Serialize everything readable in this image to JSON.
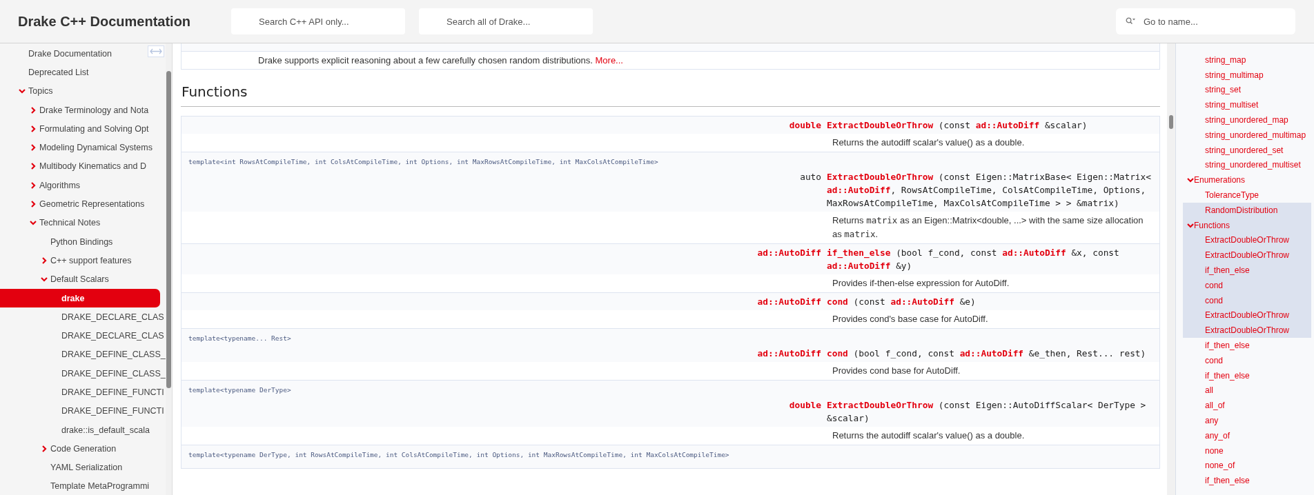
{
  "header": {
    "title": "Drake C++ Documentation",
    "search_fields": [
      {
        "placeholder": "Search C++ API only..."
      },
      {
        "placeholder": "Search all of Drake..."
      }
    ],
    "go_to": {
      "placeholder": "Go to name..."
    }
  },
  "sidebar": {
    "items": [
      {
        "label": "Drake Documentation",
        "selected": false
      },
      {
        "label": "Deprecated List",
        "selected": false
      },
      {
        "label": "Topics",
        "expanded": true,
        "selected": false,
        "children": [
          {
            "label": "Drake Terminology and Nota",
            "expanded": false,
            "selected": false
          },
          {
            "label": "Formulating and Solving Opt",
            "expanded": false,
            "selected": false
          },
          {
            "label": "Modeling Dynamical Systems",
            "expanded": false,
            "selected": false
          },
          {
            "label": "Multibody Kinematics and D",
            "expanded": false,
            "selected": false
          },
          {
            "label": "Algorithms",
            "expanded": false,
            "selected": false
          },
          {
            "label": "Geometric Representations",
            "expanded": false,
            "selected": false
          },
          {
            "label": "Technical Notes",
            "expanded": true,
            "selected": false,
            "children": [
              {
                "label": "Python Bindings",
                "selected": false
              },
              {
                "label": "C++ support features",
                "expanded": false,
                "selected": false
              },
              {
                "label": "Default Scalars",
                "expanded": true,
                "selected": false,
                "children": [
                  {
                    "label": "drake",
                    "selected": true
                  },
                  {
                    "label": "DRAKE_DECLARE_CLAS",
                    "selected": false
                  },
                  {
                    "label": "DRAKE_DECLARE_CLAS",
                    "selected": false
                  },
                  {
                    "label": "DRAKE_DEFINE_CLASS_",
                    "selected": false
                  },
                  {
                    "label": "DRAKE_DEFINE_CLASS_",
                    "selected": false
                  },
                  {
                    "label": "DRAKE_DEFINE_FUNCTI",
                    "selected": false
                  },
                  {
                    "label": "DRAKE_DEFINE_FUNCTI",
                    "selected": false
                  },
                  {
                    "label": "drake::is_default_scala",
                    "selected": false
                  }
                ]
              },
              {
                "label": "Code Generation",
                "expanded": false,
                "selected": false
              },
              {
                "label": "YAML Serialization",
                "selected": false
              },
              {
                "label": "Template MetaProgrammi",
                "selected": false
              }
            ]
          }
        ]
      }
    ]
  },
  "summary": {
    "text": "Drake supports explicit reasoning about a few carefully chosen random distributions.",
    "link": "More..."
  },
  "functions": {
    "heading": "Functions",
    "rows": [
      {
        "return_type": "**double**",
        "signature": "**ExtractDoubleOrThrow** (const **ad::AutoDiff** &scalar)",
        "description": [
          {
            "kind": "text",
            "text": "Returns the autodiff scalar's value() as a double."
          }
        ]
      },
      {
        "template": "template<int RowsAtCompileTime, int ColsAtCompileTime, int Options, int MaxRowsAtCompileTime, int MaxColsAtCompileTime>",
        "return_type": "auto",
        "signature": "**ExtractDoubleOrThrow** (const Eigen::MatrixBase< Eigen::Matrix< **ad::AutoDiff**, RowsAtCompileTime, ColsAtCompileTime, Options, MaxRowsAtCompileTime, MaxColsAtCompileTime > > &matrix)",
        "description": [
          {
            "kind": "text",
            "text": "Returns "
          },
          {
            "kind": "code",
            "text": "matrix"
          },
          {
            "kind": "text",
            "text": " as an Eigen::Matrix<double, ...> with the same size allocation as "
          },
          {
            "kind": "code",
            "text": "matrix"
          },
          {
            "kind": "text",
            "text": "."
          }
        ]
      },
      {
        "return_type": "**ad::AutoDiff**",
        "signature": "**if_then_else** (bool f_cond, const **ad::AutoDiff** &x, const **ad::AutoDiff** &y)",
        "description": [
          {
            "kind": "text",
            "text": "Provides if-then-else expression for AutoDiff."
          }
        ]
      },
      {
        "return_type": "**ad::AutoDiff**",
        "signature": "**cond** (const **ad::AutoDiff** &e)",
        "description": [
          {
            "kind": "text",
            "text": "Provides cond's base case for AutoDiff."
          }
        ]
      },
      {
        "template": "template<typename... Rest>",
        "return_type": "**ad::AutoDiff**",
        "signature": "**cond** (bool f_cond, const **ad::AutoDiff** &e_then, Rest... rest)",
        "description": [
          {
            "kind": "text",
            "text": "Provides cond base for AutoDiff."
          }
        ]
      },
      {
        "template": "template<typename DerType>",
        "return_type": "**double**",
        "signature": "**ExtractDoubleOrThrow** (const Eigen::AutoDiffScalar< DerType > &scalar)",
        "description": [
          {
            "kind": "text",
            "text": "Returns the autodiff scalar's value() as a double."
          }
        ]
      },
      {
        "template": "template<typename DerType, int RowsAtCompileTime, int ColsAtCompileTime, int Options, int MaxRowsAtCompileTime, int MaxColsAtCompileTime>"
      }
    ]
  },
  "nav": {
    "continued": [
      {
        "label": "string_map",
        "highlighted": false
      },
      {
        "label": "string_multimap",
        "highlighted": false
      },
      {
        "label": "string_set",
        "highlighted": false
      },
      {
        "label": "string_multiset",
        "highlighted": false
      },
      {
        "label": "string_unordered_map",
        "highlighted": false
      },
      {
        "label": "string_unordered_multimap",
        "highlighted": false
      },
      {
        "label": "string_unordered_set",
        "highlighted": false
      },
      {
        "label": "string_unordered_multiset",
        "highlighted": false
      }
    ],
    "sections": [
      {
        "label": "Enumerations",
        "expanded": true,
        "highlighted": false,
        "children": [
          {
            "label": "ToleranceType",
            "highlighted": false
          },
          {
            "label": "RandomDistribution",
            "highlighted": true
          }
        ]
      },
      {
        "label": "Functions",
        "expanded": true,
        "highlighted": true,
        "children": [
          {
            "label": "ExtractDoubleOrThrow",
            "highlighted": true
          },
          {
            "label": "ExtractDoubleOrThrow",
            "highlighted": true
          },
          {
            "label": "if_then_else",
            "highlighted": true
          },
          {
            "label": "cond",
            "highlighted": true
          },
          {
            "label": "cond",
            "highlighted": true
          },
          {
            "label": "ExtractDoubleOrThrow",
            "highlighted": true
          },
          {
            "label": "ExtractDoubleOrThrow",
            "highlighted": true
          },
          {
            "label": "if_then_else",
            "highlighted": false
          },
          {
            "label": "cond",
            "highlighted": false
          },
          {
            "label": "if_then_else",
            "highlighted": false
          },
          {
            "label": "all",
            "highlighted": false
          },
          {
            "label": "all_of",
            "highlighted": false
          },
          {
            "label": "any",
            "highlighted": false
          },
          {
            "label": "any_of",
            "highlighted": false
          },
          {
            "label": "none",
            "highlighted": false
          },
          {
            "label": "none_of",
            "highlighted": false
          },
          {
            "label": "if_then_else",
            "highlighted": false
          }
        ]
      }
    ]
  }
}
